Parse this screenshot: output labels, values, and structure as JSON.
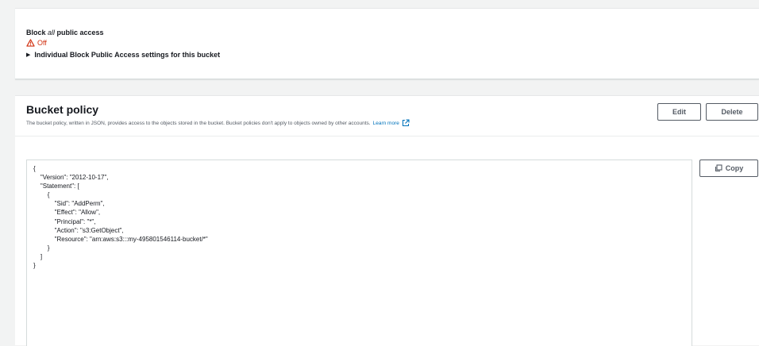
{
  "block_public_access": {
    "title_prefix": "Block ",
    "title_emphasis": "all",
    "title_suffix": " public access",
    "status": "Off",
    "expander_label": "Individual Block Public Access settings for this bucket"
  },
  "bucket_policy": {
    "title": "Bucket policy",
    "description": "The bucket policy, written in JSON, provides access to the objects stored in the bucket. Bucket policies don't apply to objects owned by other accounts.",
    "learn_more": "Learn more",
    "edit_label": "Edit",
    "delete_label": "Delete",
    "copy_label": "Copy",
    "policy_lines": [
      "{",
      "    \"Version\": \"2012-10-17\",",
      "    \"Statement\": [",
      "        {",
      "            \"Sid\": \"AddPerm\",",
      "            \"Effect\": \"Allow\",",
      "            \"Principal\": \"*\",",
      "            \"Action\": \"s3:GetObject\",",
      "            \"Resource\": \"arn:aws:s3:::my-495801546114-bucket/*\"",
      "        }",
      "    ]",
      "}"
    ]
  },
  "colors": {
    "warning": "#d13212",
    "link": "#0073bb",
    "button_border": "#545b64"
  },
  "icons": {
    "warning": "warning-triangle-icon",
    "external": "external-link-icon",
    "copy": "copy-icon",
    "expander": "caret-right-icon"
  }
}
